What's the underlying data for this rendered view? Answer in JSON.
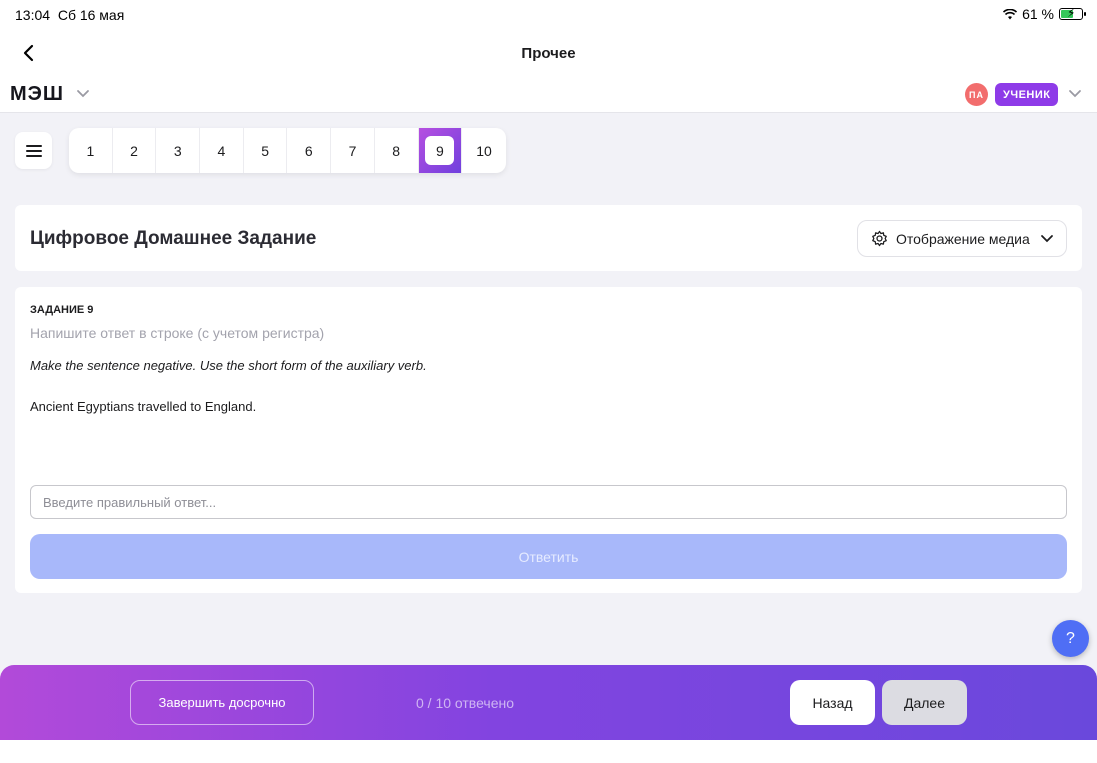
{
  "status_bar": {
    "time": "13:04",
    "date": "Сб 16 мая",
    "battery_percent": "61 %",
    "battery_level": 0.61
  },
  "nav": {
    "title": "Прочее",
    "back_icon": "chevron-left-icon"
  },
  "app_header": {
    "logo": "МЭШ",
    "avatar_initials": "ПА",
    "role": "УЧЕНИК"
  },
  "question_nav": {
    "numbers": [
      "1",
      "2",
      "3",
      "4",
      "5",
      "6",
      "7",
      "8",
      "9",
      "10"
    ],
    "active_index": 8
  },
  "title_card": {
    "heading": "Цифровое Домашнее Задание",
    "media_button": "Отображение медиа"
  },
  "task": {
    "label": "ЗАДАНИЕ 9",
    "hint": "Напишите ответ в строке (с учетом регистра)",
    "instruction": "Make the sentence negative. Use the short form of the auxiliary verb.",
    "sentence": "Ancient Egyptians travelled to England.",
    "input_placeholder": "Введите правильный ответ...",
    "input_value": "",
    "submit_label": "Ответить"
  },
  "help": {
    "label": "?"
  },
  "footer": {
    "finish_label": "Завершить досрочно",
    "progress": "0 / 10 отвечено",
    "prev_label": "Назад",
    "next_label": "Далее"
  },
  "colors": {
    "accent_purple": "#8e3be8",
    "submit_disabled": "#a8b8fa",
    "help_blue": "#4f6ef5",
    "footer_gradient_start": "#b24ad9",
    "footer_gradient_end": "#6a48dc"
  }
}
